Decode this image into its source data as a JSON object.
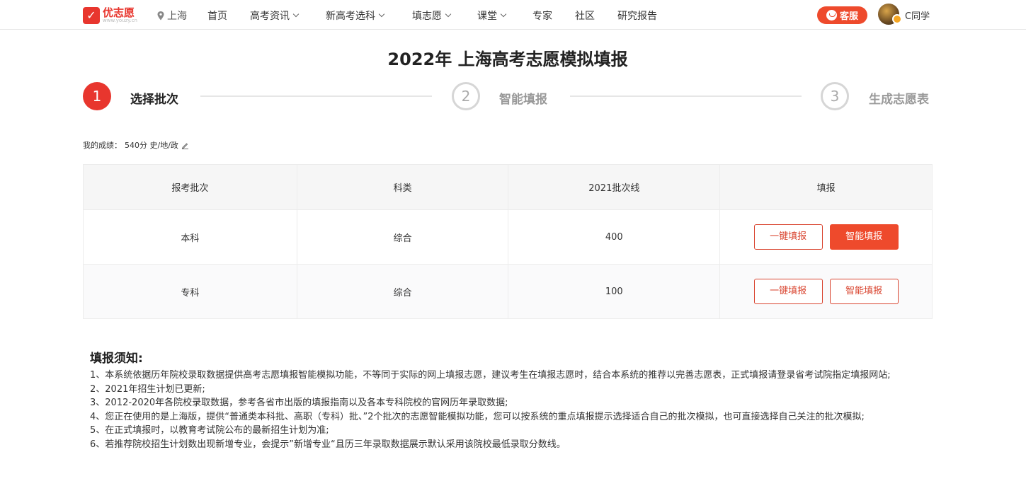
{
  "nav": {
    "logo_text": "优志愿",
    "logo_sub": "www.youzy.cn",
    "location": "上海",
    "items": [
      {
        "label": "首页",
        "dropdown": false
      },
      {
        "label": "高考资讯",
        "dropdown": true
      },
      {
        "label": "新高考选科",
        "dropdown": true
      },
      {
        "label": "填志愿",
        "dropdown": true
      },
      {
        "label": "课堂",
        "dropdown": true
      },
      {
        "label": "专家",
        "dropdown": false
      },
      {
        "label": "社区",
        "dropdown": false
      },
      {
        "label": "研究报告",
        "dropdown": false
      }
    ],
    "service_label": "客服",
    "username": "C同学"
  },
  "page_title": "2022年 上海高考志愿模拟填报",
  "steps": [
    {
      "number": "1",
      "label": "选择批次",
      "active": true
    },
    {
      "number": "2",
      "label": "智能填报",
      "active": false
    },
    {
      "number": "3",
      "label": "生成志愿表",
      "active": false
    }
  ],
  "score": {
    "label": "我的成绩：",
    "value": "540分 史/地/政"
  },
  "table": {
    "headers": [
      "报考批次",
      "科类",
      "2021批次线",
      "填报"
    ],
    "rows": [
      {
        "batch": "本科",
        "category": "综合",
        "line": "400",
        "btn_quick": "一键填报",
        "btn_smart": "智能填报",
        "smart_style": "solid"
      },
      {
        "batch": "专科",
        "category": "综合",
        "line": "100",
        "btn_quick": "一键填报",
        "btn_smart": "智能填报",
        "smart_style": "outline"
      }
    ]
  },
  "notes": {
    "title": "填报须知:",
    "items": [
      "1、本系统依据历年院校录取数据提供高考志愿填报智能模拟功能，不等同于实际的网上填报志愿，建议考生在填报志愿时，结合本系统的推荐以完善志愿表，正式填报请登录省考试院指定填报网站;",
      "2、2021年招生计划已更新;",
      "3、2012-2020年各院校录取数据，参考各省市出版的填报指南以及各本专科院校的官网历年录取数据;",
      "4、您正在使用的是上海版，提供“普通类本科批、高职（专科）批、”2个批次的志愿智能模拟功能，您可以按系统的重点填报提示选择适合自己的批次模拟，也可直接选择自己关注的批次模拟;",
      "5、在正式填报时，以教育考试院公布的最新招生计划为准;",
      "6、若推荐院校招生计划数出现新增专业，会提示”新增专业“且历三年录取数据展示默认采用该院校最低录取分数线。"
    ]
  },
  "colors": {
    "brand": "#e8362e",
    "accent": "#ee4a2c"
  }
}
